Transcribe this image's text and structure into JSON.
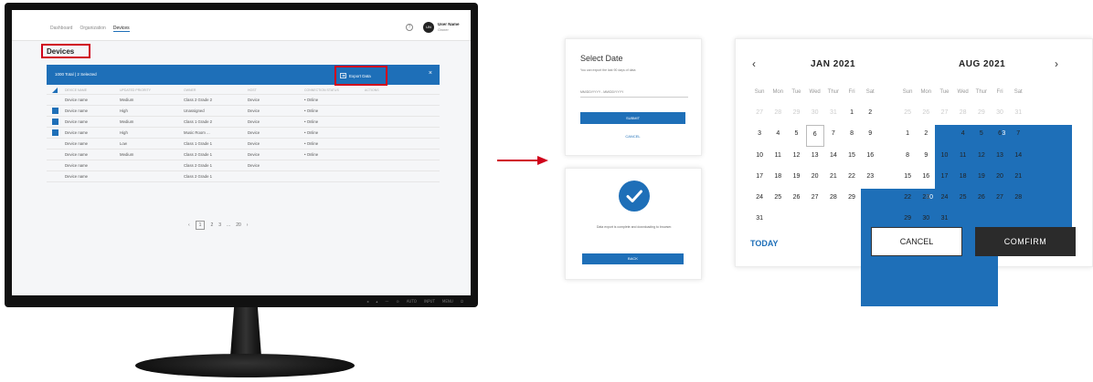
{
  "monitor": {
    "nav": [
      "Dashboard",
      "Organization",
      "Devices"
    ],
    "help_icon": "?",
    "avatar": "UN",
    "user_name": "User Name",
    "user_role": "Owner",
    "page_title": "Devices",
    "selection_info": "1000 Total   |   2 Selected",
    "export_label": "Export Data",
    "close_icon": "×",
    "table": {
      "headers": [
        "DEVICE NAME",
        "UPDATED PRIORITY",
        "OWNER",
        "HOST",
        "CONNECTION STATUS",
        "ACTIONS"
      ],
      "rows": [
        {
          "checked": false,
          "name": "Device name",
          "priority": "Medium",
          "owner": "Class 2 Grade 2",
          "host": "Device",
          "status": "• Online"
        },
        {
          "checked": true,
          "name": "Device name",
          "priority": "High",
          "owner": "Unassigned",
          "host": "Device",
          "status": "• Online"
        },
        {
          "checked": true,
          "name": "Device name",
          "priority": "Medium",
          "owner": "Class 1 Grade 2",
          "host": "Device",
          "status": "• Online"
        },
        {
          "checked": true,
          "name": "Device name",
          "priority": "High",
          "owner": "Music Room ...",
          "host": "Device",
          "status": "• Online"
        },
        {
          "checked": false,
          "name": "Device name",
          "priority": "Low",
          "owner": "Class 1 Grade 1",
          "host": "Device",
          "status": "• Online"
        },
        {
          "checked": false,
          "name": "Device name",
          "priority": "Medium",
          "owner": "Class 2 Grade 1",
          "host": "Device",
          "status": "• Online"
        },
        {
          "checked": false,
          "name": "Device name",
          "priority": "",
          "owner": "Class 2 Grade 1",
          "host": "Device",
          "status": ""
        },
        {
          "checked": false,
          "name": "Device name",
          "priority": "",
          "owner": "Class 2 Grade 1",
          "host": "",
          "status": ""
        }
      ]
    },
    "pager": [
      "‹",
      "1",
      "2",
      "3",
      "...",
      "20",
      "›"
    ],
    "bezel_buttons": [
      "◂",
      "▴",
      "—",
      "⊙",
      "AUTO",
      "INPUT",
      "MENU",
      "⏻"
    ]
  },
  "select_date": {
    "title": "Select Date",
    "subtitle": "You can export the last 90 days of data",
    "range_placeholder": "MM/DD/YYYY - MM/DD/YYYY",
    "submit_label": "SUBMIT",
    "cancel_label": "CANCEL"
  },
  "done": {
    "message": "Data export is complete and downloading to browser.",
    "back_label": "BACK"
  },
  "calendar": {
    "prev_icon": "‹",
    "next_icon": "›",
    "weekdays": [
      "Sun",
      "Mon",
      "Tue",
      "Wed",
      "Thur",
      "Fri",
      "Sat"
    ],
    "months": [
      {
        "label": "JAN 2021",
        "days": [
          {
            "t": "27",
            "s": "out"
          },
          {
            "t": "28",
            "s": "out"
          },
          {
            "t": "29",
            "s": "out"
          },
          {
            "t": "30",
            "s": "out"
          },
          {
            "t": "31",
            "s": "out"
          },
          {
            "t": "1",
            "s": ""
          },
          {
            "t": "2",
            "s": ""
          },
          {
            "t": "3",
            "s": ""
          },
          {
            "t": "4",
            "s": ""
          },
          {
            "t": "5",
            "s": ""
          },
          {
            "t": "6",
            "s": "today"
          },
          {
            "t": "7",
            "s": ""
          },
          {
            "t": "8",
            "s": ""
          },
          {
            "t": "9",
            "s": ""
          },
          {
            "t": "10",
            "s": ""
          },
          {
            "t": "11",
            "s": ""
          },
          {
            "t": "12",
            "s": ""
          },
          {
            "t": "13",
            "s": ""
          },
          {
            "t": "14",
            "s": ""
          },
          {
            "t": "15",
            "s": ""
          },
          {
            "t": "16",
            "s": ""
          },
          {
            "t": "17",
            "s": ""
          },
          {
            "t": "18",
            "s": ""
          },
          {
            "t": "19",
            "s": ""
          },
          {
            "t": "20",
            "s": ""
          },
          {
            "t": "21",
            "s": ""
          },
          {
            "t": "22",
            "s": ""
          },
          {
            "t": "23",
            "s": ""
          },
          {
            "t": "24",
            "s": ""
          },
          {
            "t": "25",
            "s": ""
          },
          {
            "t": "26",
            "s": ""
          },
          {
            "t": "27",
            "s": ""
          },
          {
            "t": "28",
            "s": ""
          },
          {
            "t": "29",
            "s": ""
          },
          {
            "t": "30",
            "s": "sel"
          },
          {
            "t": "31",
            "s": ""
          }
        ]
      },
      {
        "label": "AUG 2021",
        "days": [
          {
            "t": "25",
            "s": "out"
          },
          {
            "t": "26",
            "s": "out"
          },
          {
            "t": "27",
            "s": "out"
          },
          {
            "t": "28",
            "s": "out"
          },
          {
            "t": "29",
            "s": "out"
          },
          {
            "t": "30",
            "s": "out"
          },
          {
            "t": "31",
            "s": "out"
          },
          {
            "t": "1",
            "s": ""
          },
          {
            "t": "2",
            "s": ""
          },
          {
            "t": "3",
            "s": "sel"
          },
          {
            "t": "4",
            "s": ""
          },
          {
            "t": "5",
            "s": ""
          },
          {
            "t": "6",
            "s": ""
          },
          {
            "t": "7",
            "s": ""
          },
          {
            "t": "8",
            "s": ""
          },
          {
            "t": "9",
            "s": ""
          },
          {
            "t": "10",
            "s": ""
          },
          {
            "t": "11",
            "s": ""
          },
          {
            "t": "12",
            "s": ""
          },
          {
            "t": "13",
            "s": ""
          },
          {
            "t": "14",
            "s": ""
          },
          {
            "t": "15",
            "s": ""
          },
          {
            "t": "16",
            "s": ""
          },
          {
            "t": "17",
            "s": ""
          },
          {
            "t": "18",
            "s": ""
          },
          {
            "t": "19",
            "s": ""
          },
          {
            "t": "20",
            "s": ""
          },
          {
            "t": "21",
            "s": ""
          },
          {
            "t": "22",
            "s": ""
          },
          {
            "t": "23",
            "s": ""
          },
          {
            "t": "24",
            "s": ""
          },
          {
            "t": "25",
            "s": ""
          },
          {
            "t": "26",
            "s": ""
          },
          {
            "t": "27",
            "s": ""
          },
          {
            "t": "28",
            "s": ""
          },
          {
            "t": "29",
            "s": ""
          },
          {
            "t": "30",
            "s": ""
          },
          {
            "t": "31",
            "s": ""
          }
        ]
      }
    ],
    "today_label": "TODAY",
    "cancel_label": "CANCEL",
    "confirm_label": "COMFIRM"
  },
  "colors": {
    "accent": "#1e6fb8",
    "highlight": "#d0021b",
    "confirm_bg": "#2b2b2b"
  }
}
